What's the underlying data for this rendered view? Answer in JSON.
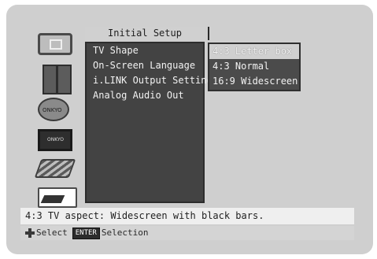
{
  "title": "Initial Setup",
  "menu": {
    "items": [
      "TV Shape",
      "On-Screen Language",
      "i.LINK Output Setting",
      "Analog Audio Out"
    ]
  },
  "submenu": {
    "items": [
      "4:3 Letter box",
      "4:3 Normal",
      "16:9 Widescreen"
    ],
    "selected": "4:3 Letter box"
  },
  "info": {
    "text": "4:3 TV aspect: Widescreen with black bars."
  },
  "help": {
    "select_label": "Select",
    "enter_key": "ENTER",
    "selection_label": "Selection"
  },
  "icons": [
    "tv-screen-icon",
    "speakers-icon",
    "globe-icon",
    "receiver-icon",
    "cable-icon",
    "folder-icon"
  ],
  "colors": {
    "background": "#cfcfcf",
    "menu_background": "#434343",
    "highlight": "#d0d0d0",
    "info_bar": "#efefef"
  }
}
